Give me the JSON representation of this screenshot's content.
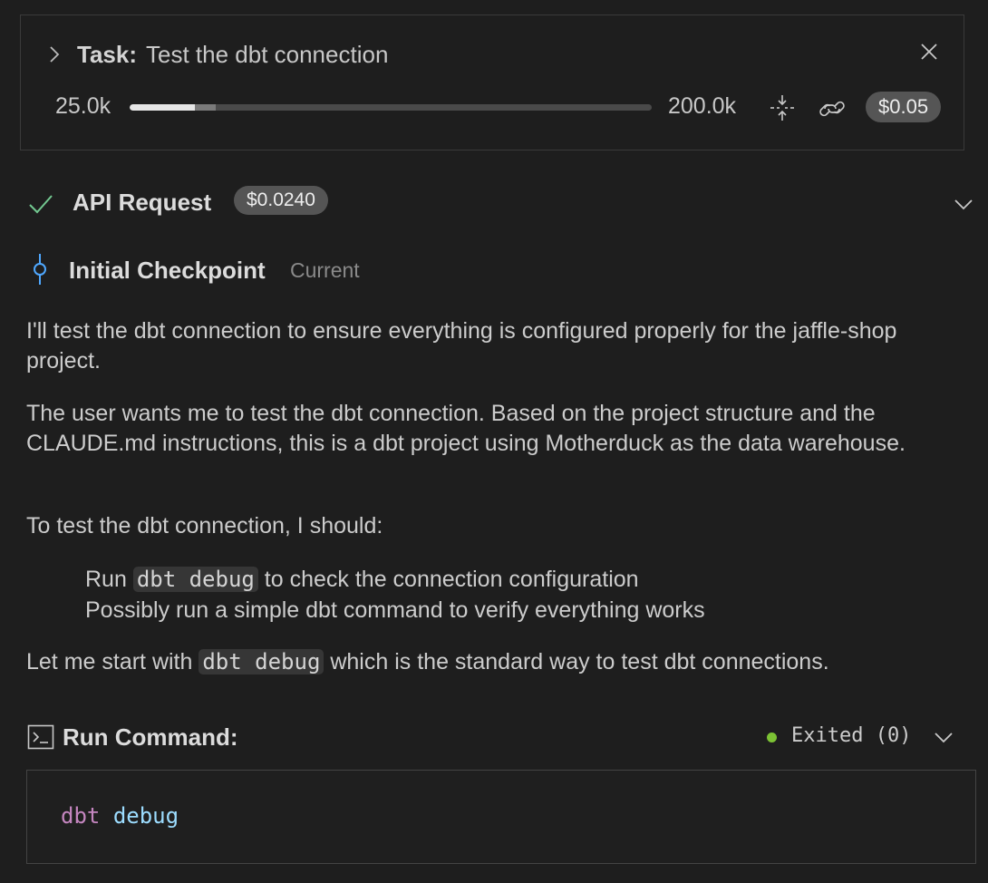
{
  "task": {
    "label": "Task:",
    "title": "Test the dbt connection",
    "chevron_icon": "chevron-right-icon",
    "close_icon": "close-icon"
  },
  "context": {
    "used_label": "25.0k",
    "max_label": "200.0k",
    "used_fraction": 0.125,
    "cache_fraction": 0.04,
    "total_cost": "$0.05"
  },
  "api_request": {
    "label": "API Request",
    "cost": "$0.0240",
    "status_icon": "check-icon",
    "status_color": "#73c991"
  },
  "checkpoint": {
    "label": "Initial Checkpoint",
    "status": "Current",
    "icon_color": "#4fa8ff"
  },
  "message": {
    "p1": "I'll test the dbt connection to ensure everything is configured properly for the jaffle-shop project.",
    "p2": "The user wants me to test the dbt connection. Based on the project structure and the CLAUDE.md instructions, this is a dbt project using Motherduck as the data warehouse.",
    "p3": "To test the dbt connection, I should:",
    "list": [
      {
        "before": "Run ",
        "code": "dbt debug",
        "after": " to check the connection configuration"
      },
      {
        "text": "Possibly run a simple dbt command to verify everything works"
      }
    ],
    "p4_before": "Let me start with ",
    "p4_code": "dbt debug",
    "p4_after": " which is the standard way to test dbt connections."
  },
  "command": {
    "label": "Run Command:",
    "status": "Exited (0)",
    "status_color": "#7cc234",
    "cmd": "dbt",
    "arg": "debug"
  }
}
